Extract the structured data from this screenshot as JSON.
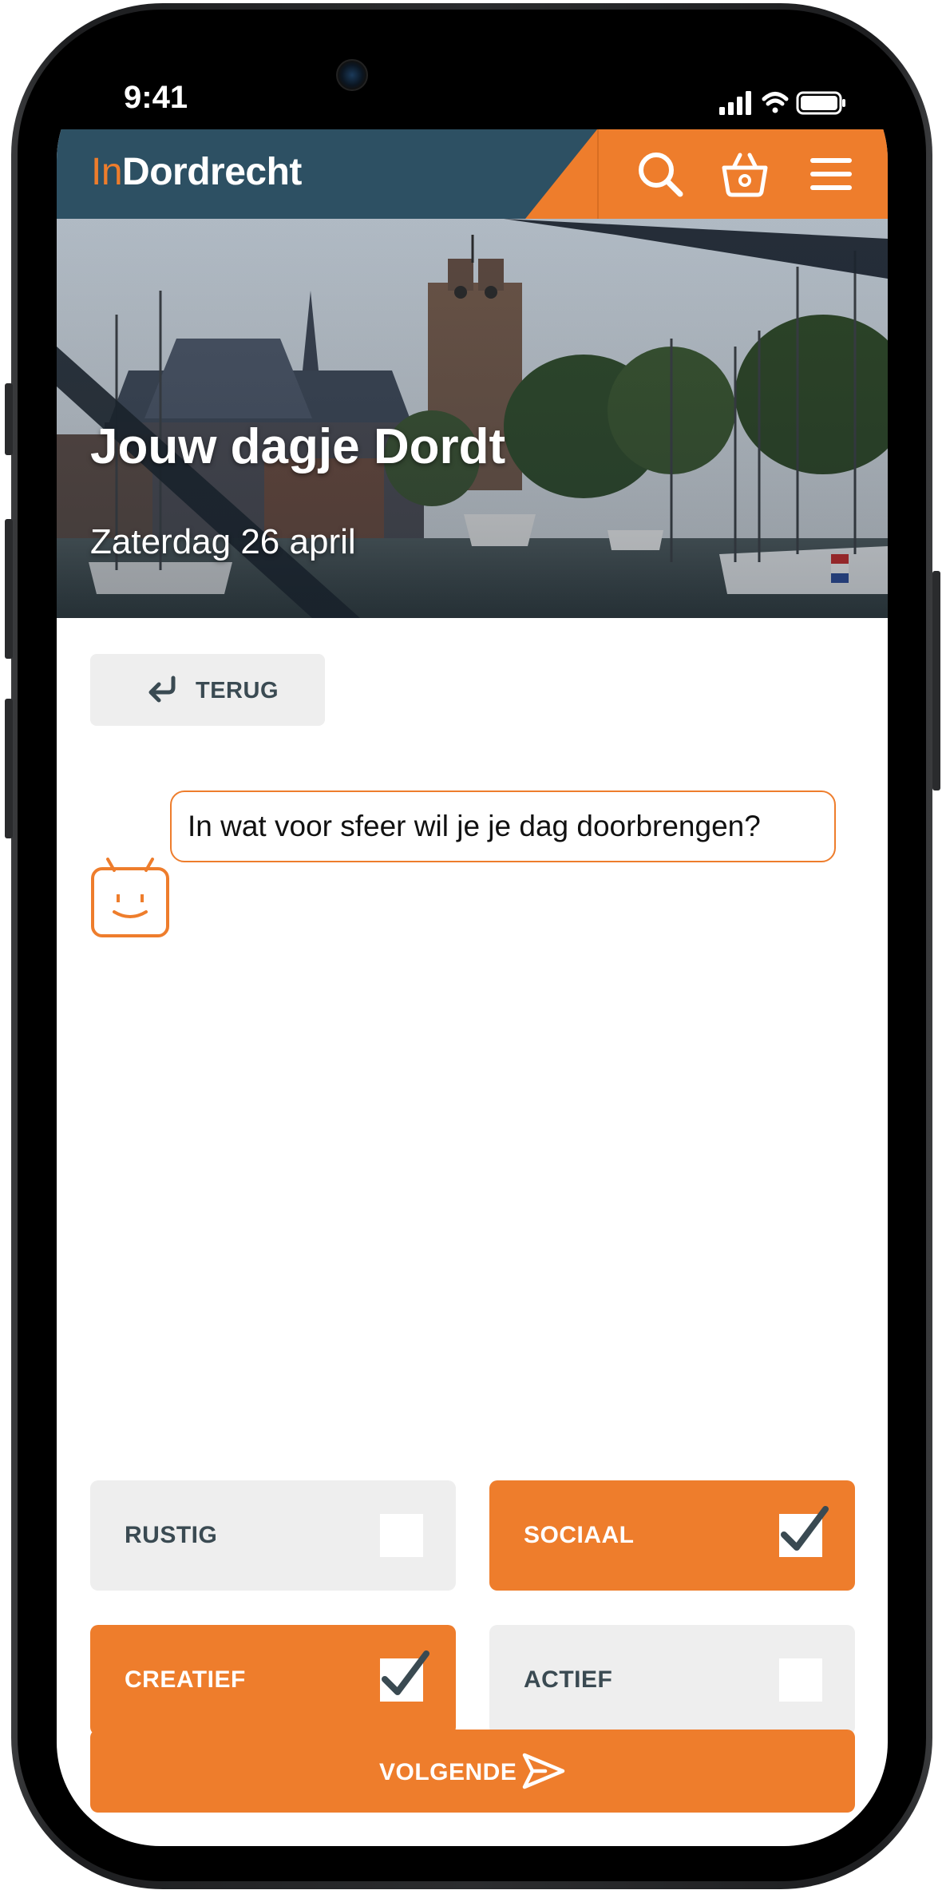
{
  "status_bar": {
    "time": "9:41"
  },
  "header": {
    "logo_prefix": "In",
    "logo_main": "Dordrecht",
    "icons": [
      "search-icon",
      "basket-icon",
      "menu-icon"
    ]
  },
  "hero": {
    "title": "Jouw dagje Dordt",
    "subtitle": "Zaterdag 26 april"
  },
  "back_button": {
    "label": "TERUG",
    "icon": "return-arrow-icon"
  },
  "chat": {
    "question": "In wat voor sfeer wil je je dag doorbrengen?",
    "avatar": "bot-face-icon"
  },
  "options": [
    {
      "label": "RUSTIG",
      "checked": false
    },
    {
      "label": "SOCIAAL",
      "checked": true
    },
    {
      "label": "CREATIEF",
      "checked": true
    },
    {
      "label": "ACTIEF",
      "checked": false
    }
  ],
  "next_button": {
    "label": "VOLGENDE",
    "icon": "send-icon"
  },
  "colors": {
    "accent": "#ee7d2c",
    "header_blue": "#2d5063",
    "option_off": "#eeeeee",
    "text_dark": "#3a4a52"
  }
}
